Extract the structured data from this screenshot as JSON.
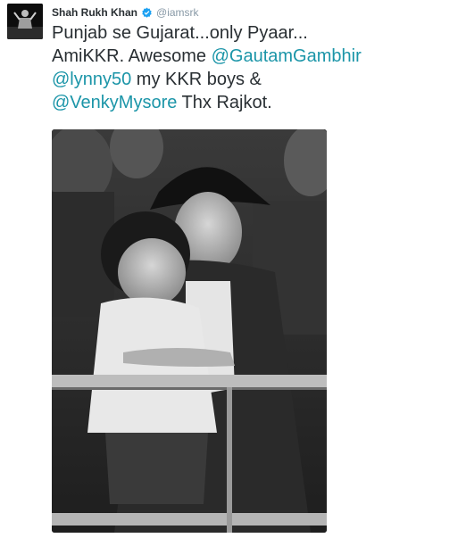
{
  "tweet": {
    "author_name": "Shah Rukh Khan",
    "author_handle": "@iamsrk",
    "verified_icon": "verified-badge-icon",
    "text_line1": "Punjab se Gujarat...only Pyaar...",
    "text_line2_prefix": "AmiKKR. Awesome ",
    "mention1": "@GautamGambhir",
    "mention2": "@lynny50",
    "text_line3_suffix": " my KKR boys &",
    "mention3": "@VenkyMysore",
    "text_line4_suffix": " Thx Rajkot."
  },
  "colors": {
    "link": "#1b95a8",
    "verified": "#1da1f2",
    "text": "#292f33",
    "handle": "#8899a6"
  }
}
